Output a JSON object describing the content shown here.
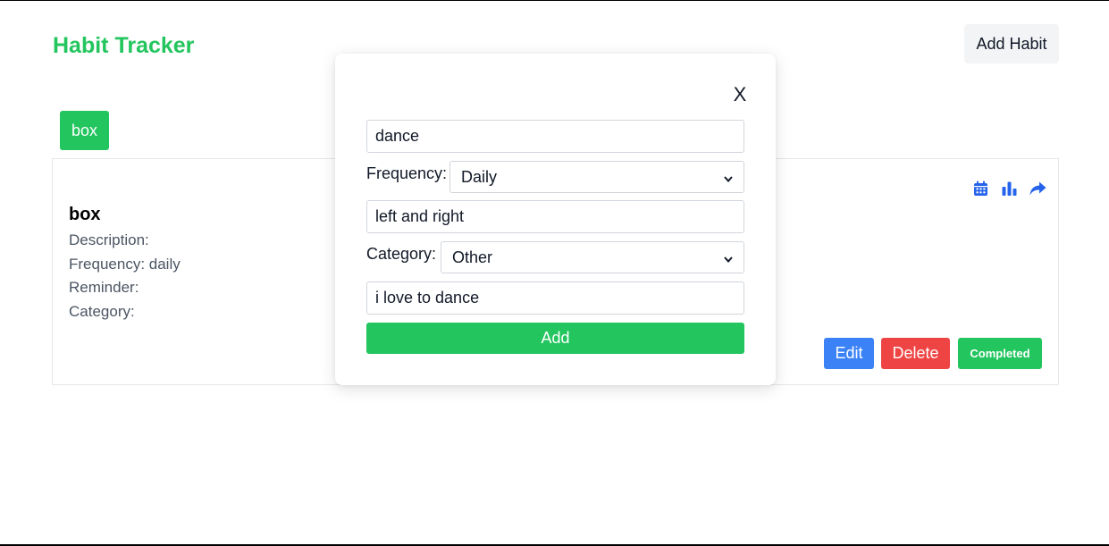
{
  "app": {
    "title": "Habit Tracker",
    "add_habit_label": "Add Habit",
    "accent_color": "#22c55e"
  },
  "tabs": [
    {
      "label": "box",
      "active": true
    }
  ],
  "habit": {
    "name": "box",
    "description_label": "Description:",
    "frequency_label": "Frequency: daily",
    "reminder_label": "Reminder:",
    "category_label": "Category:",
    "icons": [
      "calendar-icon",
      "chart-bar-icon",
      "share-icon"
    ],
    "edit_label": "Edit",
    "delete_label": "Delete",
    "completed_label": "Completed"
  },
  "modal": {
    "close_label": "X",
    "name_value": "dance",
    "frequency_label": "Frequency:",
    "frequency_selected": "Daily",
    "reminder_value": "left and right",
    "category_label": "Category:",
    "category_selected": "Other",
    "description_value": "i love to dance",
    "add_label": "Add"
  }
}
